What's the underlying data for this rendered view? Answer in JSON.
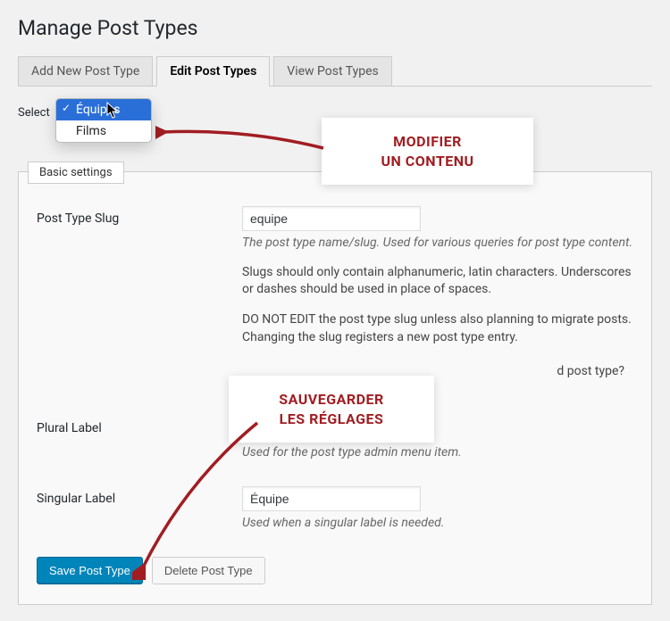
{
  "header": {
    "title": "Manage Post Types"
  },
  "tabs": {
    "add": "Add New Post Type",
    "edit": "Edit Post Types",
    "view": "View Post Types"
  },
  "select": {
    "label": "Select",
    "options": [
      "Équipes",
      "Films"
    ],
    "selected": "Équipes"
  },
  "fieldset": {
    "legend": "Basic settings"
  },
  "fields": {
    "slug": {
      "label": "Post Type Slug",
      "value": "equipe",
      "desc": "The post type name/slug. Used for various queries for post type content.",
      "help1": "Slugs should only contain alphanumeric, latin characters. Underscores or dashes should be used in place of spaces.",
      "help2": "DO NOT EDIT the post type slug unless also planning to migrate posts. Changing the slug registers a new post type entry.",
      "confirm_suffix": "d post type?"
    },
    "plural": {
      "label": "Plural Label",
      "value": "",
      "desc": "Used for the post type admin menu item."
    },
    "singular": {
      "label": "Singular Label",
      "value": "Équipe",
      "desc": "Used when a singular label is needed."
    }
  },
  "buttons": {
    "save": "Save Post Type",
    "delete": "Delete Post Type"
  },
  "callouts": {
    "modify": {
      "line1": "MODIFIER",
      "line2": "UN CONTENU"
    },
    "save": {
      "line1": "SAUVEGARDER",
      "line2": "LES RÉGLAGES"
    }
  }
}
